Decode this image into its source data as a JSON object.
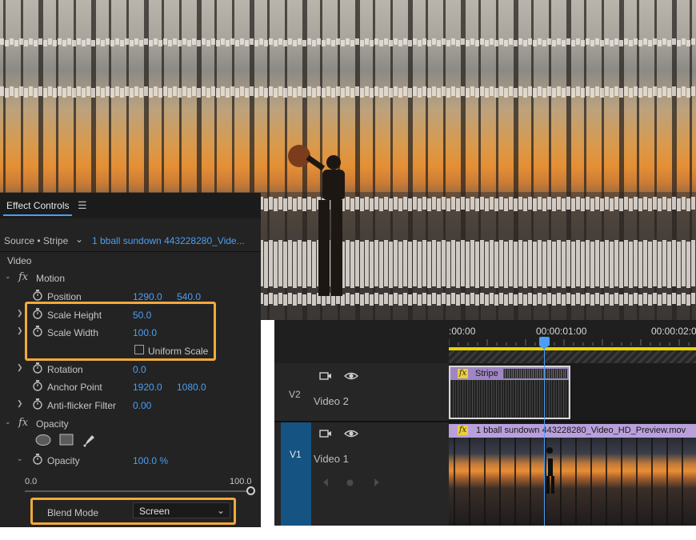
{
  "effect_controls": {
    "tab_label": "Effect Controls",
    "menu_icon": "hamburger-menu-icon",
    "source_label": "Source • Stripe",
    "clip_label": "1 bball sundown 443228280_Vide...",
    "section_label": "Video",
    "motion": {
      "label": "Motion",
      "position": {
        "label": "Position",
        "x": "1290.0",
        "y": "540.0"
      },
      "scale_height": {
        "label": "Scale Height",
        "value": "50.0"
      },
      "scale_width": {
        "label": "Scale Width",
        "value": "100.0"
      },
      "uniform_scale": {
        "label": "Uniform Scale",
        "checked": false
      },
      "rotation": {
        "label": "Rotation",
        "value": "0.0"
      },
      "anchor_point": {
        "label": "Anchor Point",
        "x": "1920.0",
        "y": "1080.0"
      },
      "anti_flicker": {
        "label": "Anti-flicker Filter",
        "value": "0.00"
      }
    },
    "opacity": {
      "label": "Opacity",
      "mask_tools": [
        "ellipse-mask-icon",
        "rectangle-mask-icon",
        "pen-mask-icon"
      ],
      "opacity_param": {
        "label": "Opacity",
        "value": "100.0 %"
      },
      "slider": {
        "min": "0.0",
        "max": "100.0",
        "level": 1.0
      },
      "blend_mode": {
        "label": "Blend Mode",
        "value": "Screen"
      }
    },
    "highlight_color": "#f2a93b",
    "value_color": "#4a9ff5"
  },
  "timeline": {
    "timecodes": [
      ":00:00",
      "00:00:01:00",
      "00:00:02:0"
    ],
    "tracks": [
      {
        "id": "V2",
        "name": "Video 2",
        "icons": [
          "film-toggle-icon",
          "eye-icon"
        ]
      },
      {
        "id": "V1",
        "name": "Video 1",
        "icons": [
          "film-toggle-icon",
          "eye-icon"
        ],
        "nav_icons": [
          "prev-keyframe-icon",
          "add-keyframe-icon",
          "next-keyframe-icon"
        ]
      }
    ],
    "clips": {
      "stripe": {
        "name": "Stripe",
        "badge": "fx"
      },
      "video": {
        "name": "1 bball sundown 443228280_Video_HD_Preview.mov",
        "badge": "fx"
      }
    },
    "playhead_color": "#4a9ff5",
    "work_area_color": "#e8d300"
  }
}
